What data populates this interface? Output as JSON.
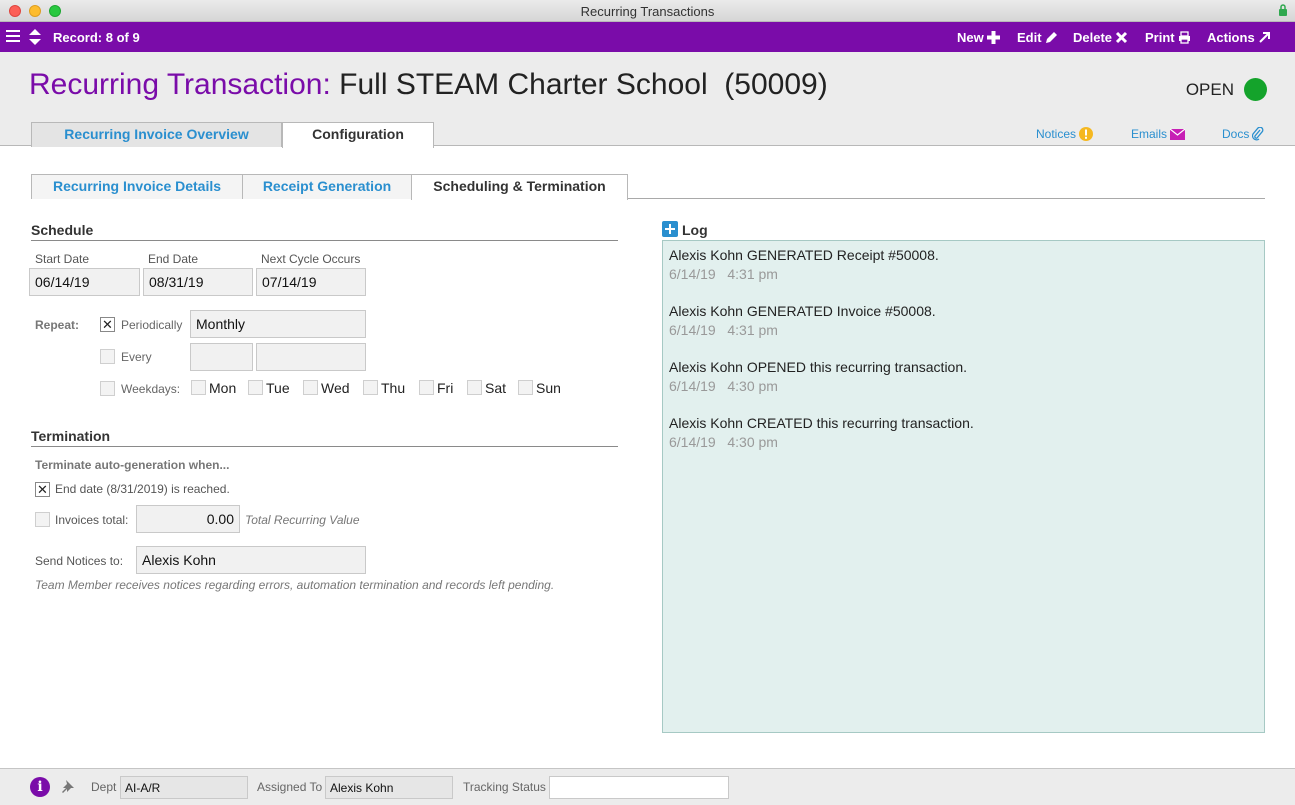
{
  "window": {
    "title": "Recurring Transactions"
  },
  "toolbar": {
    "record": "Record: 8 of 9",
    "new": "New",
    "edit": "Edit",
    "delete": "Delete",
    "print": "Print",
    "actions": "Actions"
  },
  "header": {
    "title_label": "Recurring Transaction:",
    "title_value": "Full STEAM Charter School  (50009)",
    "status": "OPEN",
    "status_color": "#14a32b",
    "accent_color": "#7a0ca9",
    "link_color": "#2a8fcf"
  },
  "main_tabs": [
    {
      "label": "Recurring Invoice Overview",
      "active": false
    },
    {
      "label": "Configuration",
      "active": true
    }
  ],
  "utility_links": {
    "notices": "Notices",
    "emails": "Emails",
    "docs": "Docs"
  },
  "sub_tabs": [
    {
      "label": "Recurring Invoice Details",
      "active": false
    },
    {
      "label": "Receipt Generation",
      "active": false
    },
    {
      "label": "Scheduling & Termination",
      "active": true
    }
  ],
  "schedule": {
    "title": "Schedule",
    "start_date_label": "Start Date",
    "start_date": "06/14/19",
    "end_date_label": "End Date",
    "end_date": "08/31/19",
    "next_cycle_label": "Next Cycle Occurs",
    "next_cycle": "07/14/19",
    "repeat_label": "Repeat:",
    "periodically_label": "Periodically",
    "periodically_checked": true,
    "periodically_value": "Monthly",
    "every_label": "Every",
    "every_checked": false,
    "weekdays_label": "Weekdays:",
    "weekdays_checked": false,
    "days": [
      "Mon",
      "Tue",
      "Wed",
      "Thu",
      "Fri",
      "Sat",
      "Sun"
    ]
  },
  "termination": {
    "title": "Termination",
    "intro": "Terminate auto-generation when...",
    "end_date_option": "End date (8/31/2019) is reached.",
    "end_date_checked": true,
    "invoices_total_label": "Invoices total:",
    "invoices_total_checked": false,
    "invoices_total_value": "0.00",
    "total_note": "Total Recurring Value",
    "send_notices_label": "Send Notices to:",
    "send_notices_value": "Alexis Kohn",
    "notice_note": "Team Member receives notices regarding errors, automation termination and records left pending."
  },
  "log": {
    "title": "Log",
    "entries": [
      {
        "text": "Alexis Kohn GENERATED Receipt #50008.",
        "time": "6/14/19   4:31 pm"
      },
      {
        "text": "Alexis Kohn GENERATED Invoice #50008.",
        "time": "6/14/19   4:31 pm"
      },
      {
        "text": "Alexis Kohn OPENED this recurring transaction.",
        "time": "6/14/19   4:30 pm"
      },
      {
        "text": "Alexis Kohn CREATED this recurring transaction.",
        "time": "6/14/19   4:30 pm"
      }
    ]
  },
  "footer": {
    "dept_label": "Dept",
    "dept_value": "AI-A/R",
    "assigned_label": "Assigned To",
    "assigned_value": "Alexis Kohn",
    "tracking_label": "Tracking Status",
    "tracking_value": ""
  }
}
